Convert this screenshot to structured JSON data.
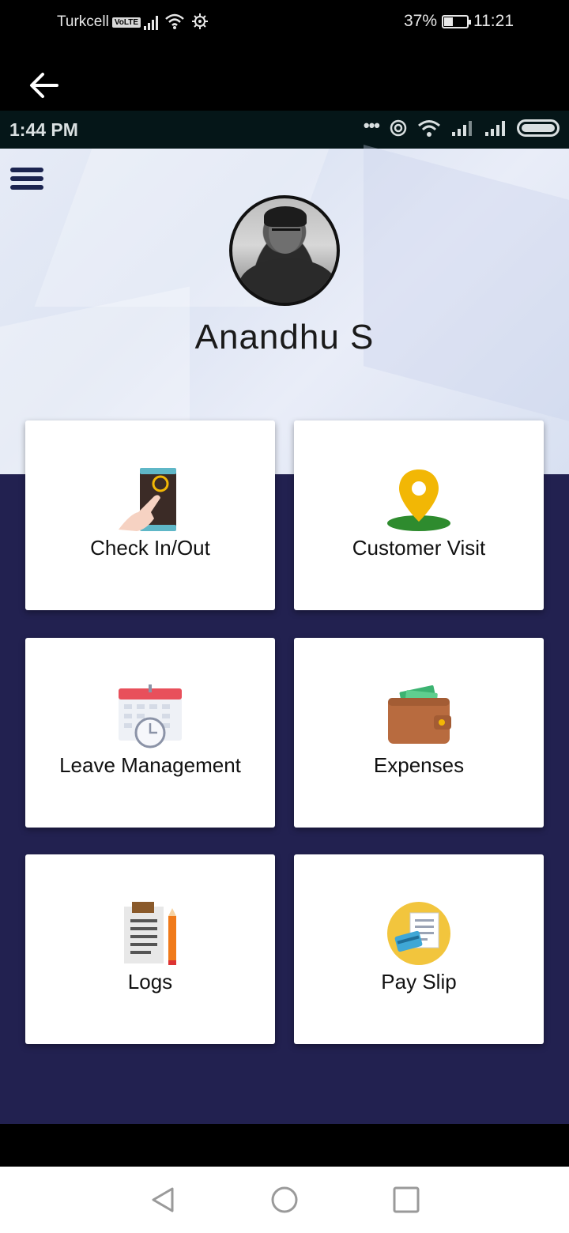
{
  "system_status": {
    "carrier": "Turkcell",
    "volte": "VoLTE",
    "battery": "37%",
    "time": "11:21"
  },
  "inner_status": {
    "time": "1:44 PM"
  },
  "profile": {
    "name": "Anandhu S"
  },
  "menu": [
    {
      "label": "Check In/Out",
      "icon": "phone-touch-icon"
    },
    {
      "label": "Customer Visit",
      "icon": "map-pin-icon"
    },
    {
      "label": "Leave Management",
      "icon": "calendar-clock-icon"
    },
    {
      "label": "Expenses",
      "icon": "wallet-icon"
    },
    {
      "label": "Logs",
      "icon": "notes-pencil-icon"
    },
    {
      "label": "Pay Slip",
      "icon": "payslip-icon"
    }
  ],
  "colors": {
    "dark_background": "#222150",
    "card": "#ffffff",
    "pin": "#f2b705",
    "wallet": "#b86b3f"
  }
}
